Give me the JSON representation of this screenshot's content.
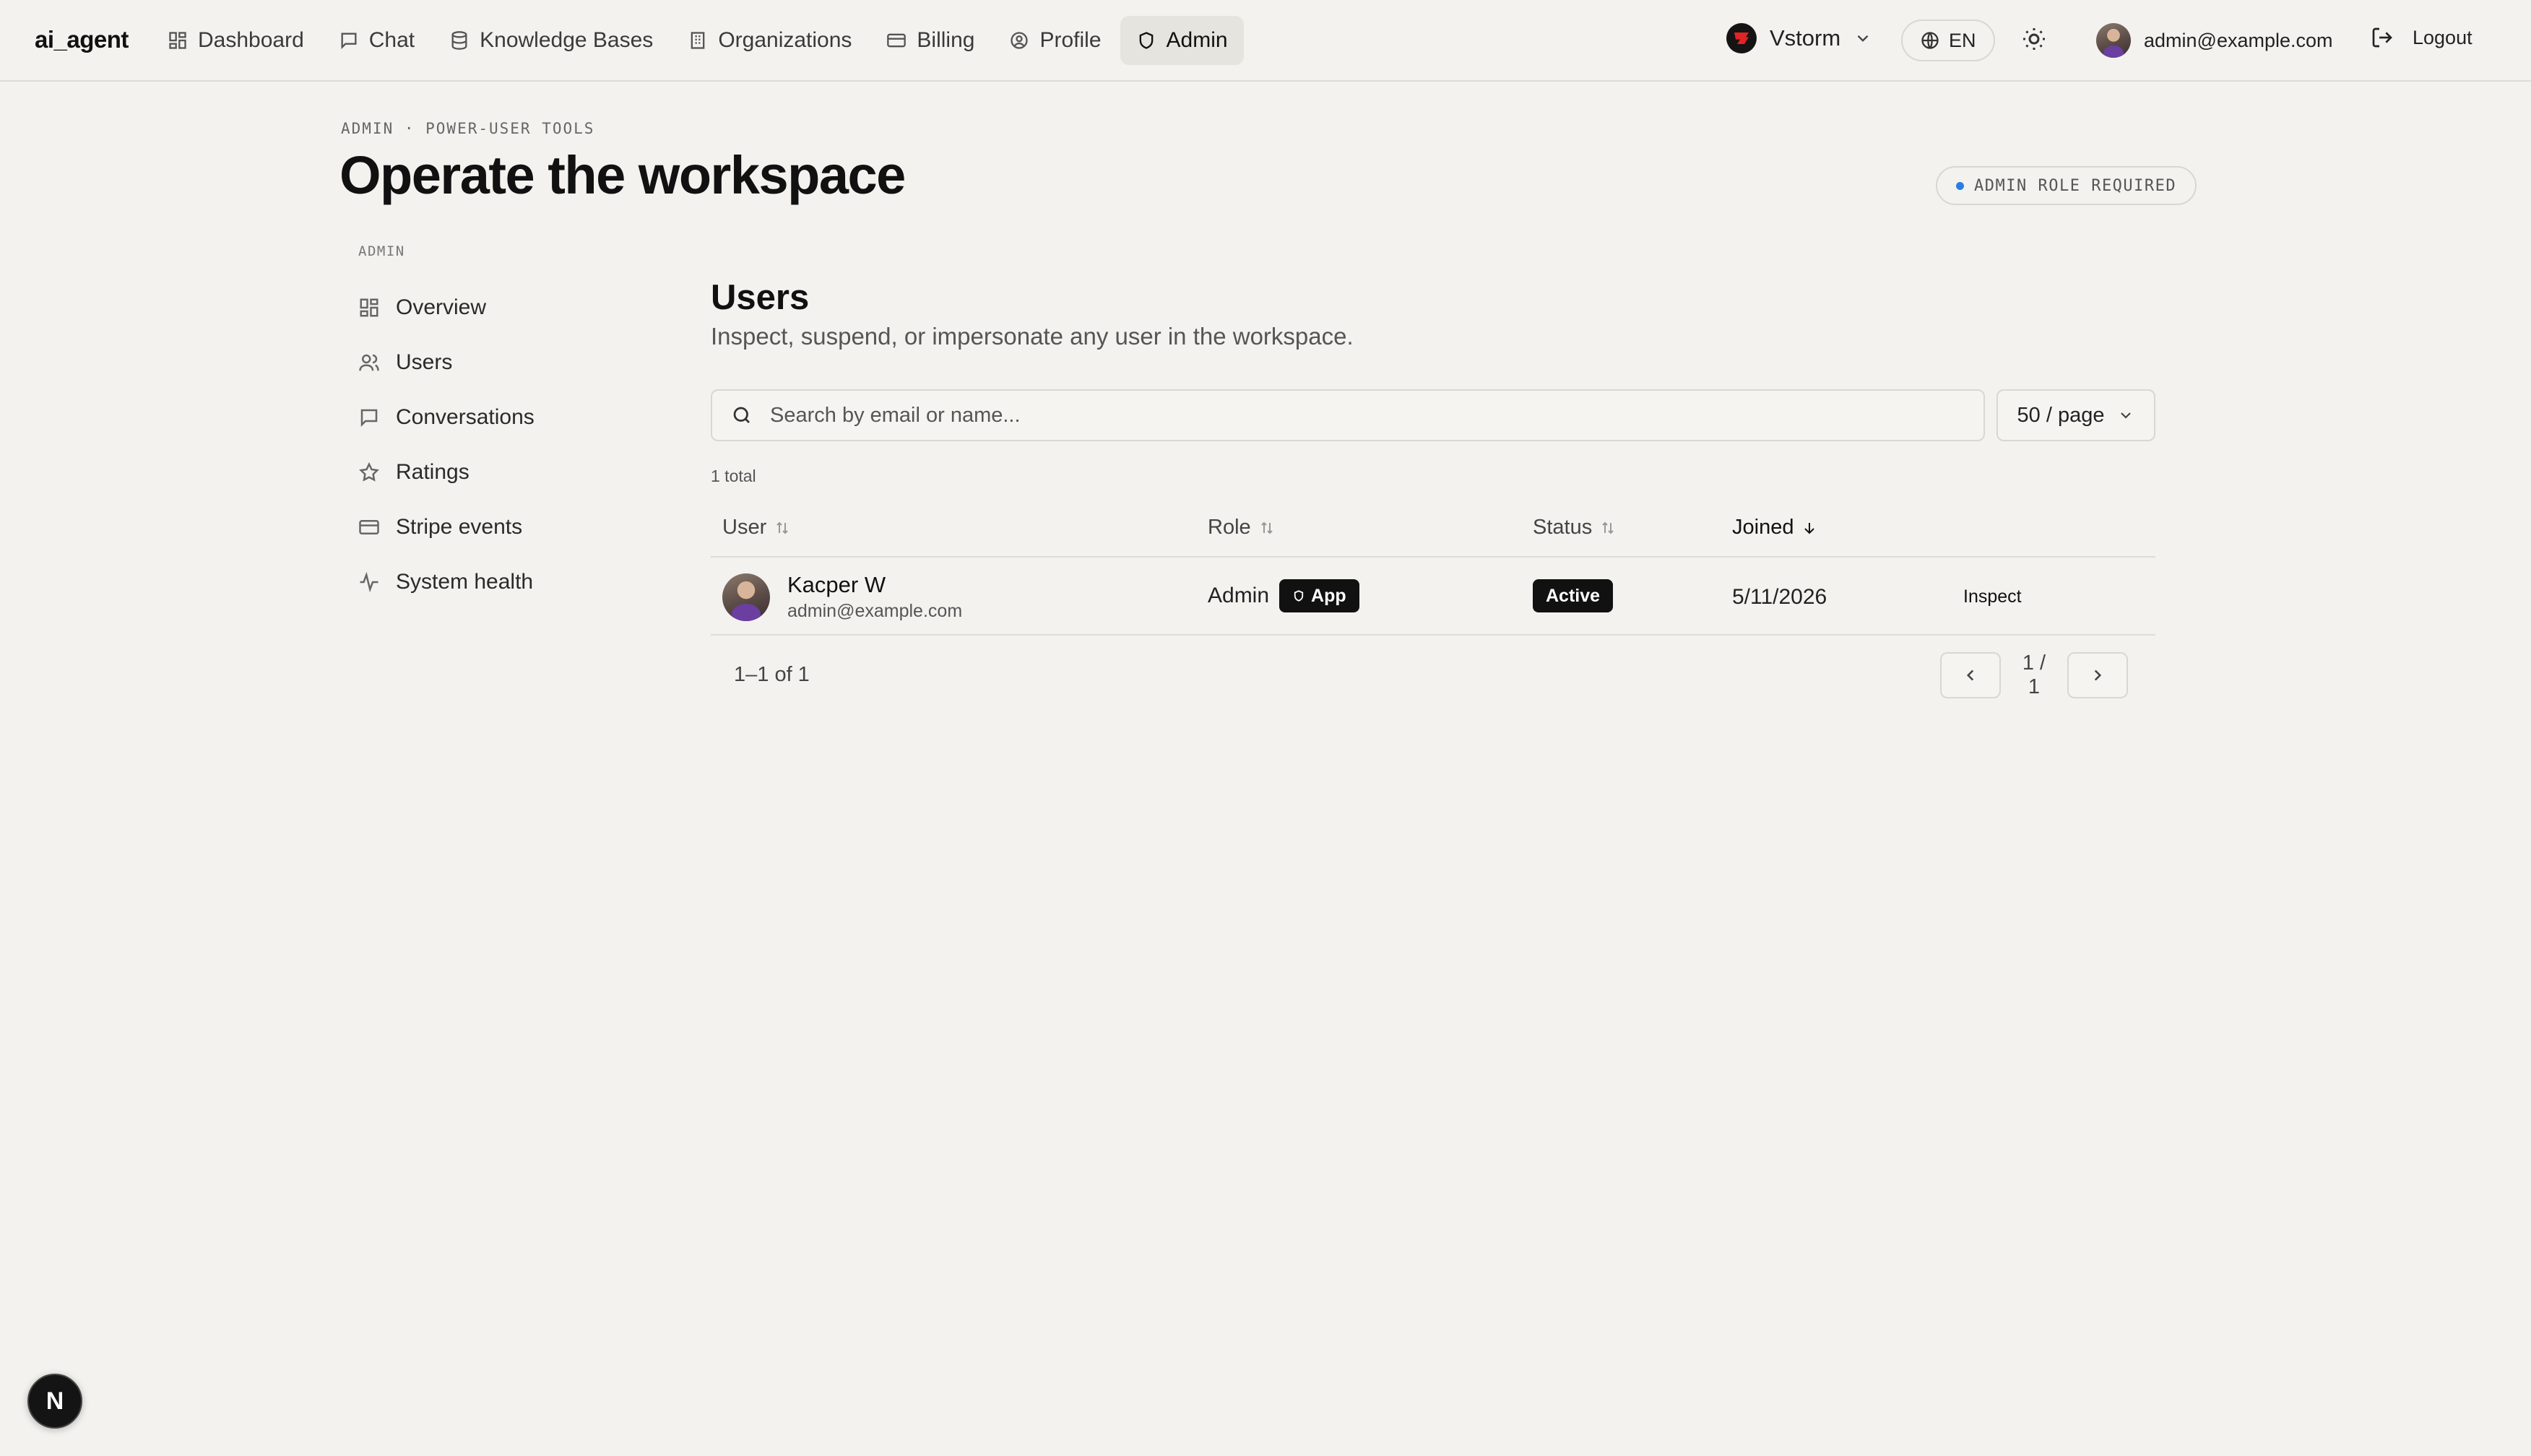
{
  "app": {
    "brand": "ai_agent"
  },
  "nav": [
    {
      "label": "Dashboard",
      "icon": "grid-icon"
    },
    {
      "label": "Chat",
      "icon": "message-icon"
    },
    {
      "label": "Knowledge Bases",
      "icon": "database-icon"
    },
    {
      "label": "Organizations",
      "icon": "building-icon"
    },
    {
      "label": "Billing",
      "icon": "credit-card-icon"
    },
    {
      "label": "Profile",
      "icon": "user-circle-icon"
    },
    {
      "label": "Admin",
      "icon": "shield-icon",
      "active": true
    }
  ],
  "topbar": {
    "workspace": "Vstorm",
    "language": "EN",
    "user_email": "admin@example.com",
    "logout": "Logout"
  },
  "header": {
    "eyebrow": "ADMIN · POWER-USER TOOLS",
    "title": "Operate the workspace",
    "badge": "ADMIN ROLE REQUIRED"
  },
  "sidebar": {
    "heading": "ADMIN",
    "items": [
      {
        "label": "Overview",
        "icon": "grid-icon"
      },
      {
        "label": "Users",
        "icon": "users-icon"
      },
      {
        "label": "Conversations",
        "icon": "message-icon"
      },
      {
        "label": "Ratings",
        "icon": "star-icon"
      },
      {
        "label": "Stripe events",
        "icon": "credit-card-icon"
      },
      {
        "label": "System health",
        "icon": "activity-icon"
      }
    ]
  },
  "main": {
    "title": "Users",
    "subtitle": "Inspect, suspend, or impersonate any user in the workspace.",
    "search_placeholder": "Search by email or name...",
    "per_page": "50 / page",
    "total": "1 total",
    "columns": {
      "user": "User",
      "role": "Role",
      "status": "Status",
      "joined": "Joined"
    },
    "rows": [
      {
        "name": "Kacper W",
        "email": "admin@example.com",
        "role": "Admin",
        "role_tag": "App",
        "status": "Active",
        "joined": "5/11/2026",
        "action": "Inspect"
      }
    ],
    "range": "1–1 of 1",
    "page": "1 / 1"
  },
  "dev_badge": "N",
  "colors": {
    "background": "#f3f2ef",
    "accent_dot": "#2a7de1",
    "pill": "#111111"
  }
}
